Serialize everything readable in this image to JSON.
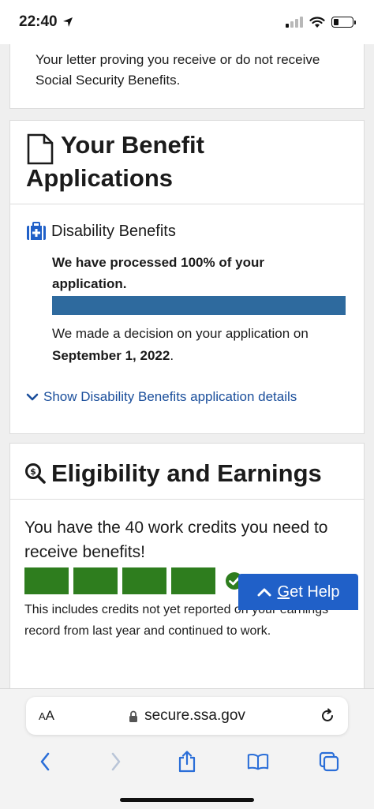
{
  "status_bar": {
    "time": "22:40"
  },
  "letter_card": {
    "text": "Your letter proving you receive or do not receive Social Security Benefits."
  },
  "benefit_applications": {
    "title_line1": "Your Benefit",
    "title_line2": "Applications",
    "benefit_name": "Disability Benefits",
    "processed_text": "We have processed 100% of your application.",
    "progress_percent": 100,
    "decision_prefix": "We made a decision on your application on ",
    "decision_date": "September 1, 2022",
    "decision_suffix": ".",
    "details_link": "Show Disability Benefits application details"
  },
  "eligibility": {
    "title": "Eligibility and Earnings",
    "credits_text": "You have the 40 work credits you need to receive benefits!",
    "credit_bars": 4,
    "note": "This includes credits not yet reported on your earnings record from last year and continued to work."
  },
  "get_help": {
    "label_first": "G",
    "label_rest": "et Help"
  },
  "safari": {
    "aa_big": "A",
    "aa_small": "A",
    "url": "secure.ssa.gov"
  },
  "colors": {
    "accent_blue": "#2e6a9e",
    "link_blue": "#1a4e9b",
    "credit_green": "#2e7d1e",
    "help_button": "#2060c8"
  }
}
